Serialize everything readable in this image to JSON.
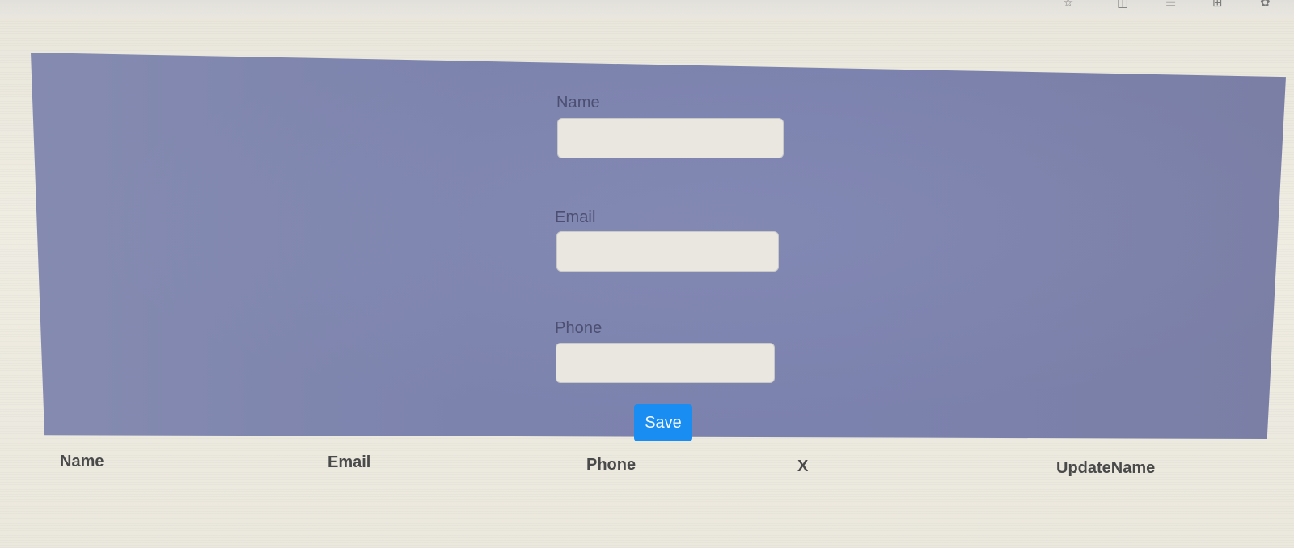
{
  "form": {
    "fields": [
      {
        "label": "Name",
        "value": "",
        "placeholder": ""
      },
      {
        "label": "Email",
        "value": "",
        "placeholder": ""
      },
      {
        "label": "Phone",
        "value": "",
        "placeholder": ""
      }
    ],
    "save_label": "Save"
  },
  "table": {
    "headers": [
      "Name",
      "Email",
      "Phone",
      "X",
      "UpdateName"
    ]
  },
  "browser_toolbar": {
    "icons": [
      "favorite-star-icon",
      "split-screen-icon",
      "favorites-list-icon",
      "collections-icon",
      "extensions-icon"
    ]
  },
  "colors": {
    "panel": "#7c83ad",
    "save_button": "#1a8df2",
    "input_background": "#e9e7e0"
  }
}
